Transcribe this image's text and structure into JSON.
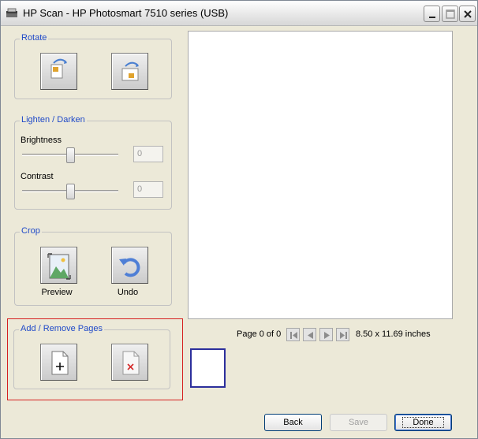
{
  "window": {
    "title": "HP Scan - HP Photosmart 7510 series (USB)"
  },
  "rotate": {
    "label": "Rotate",
    "buttons": [
      {
        "icon": "rotate-left-icon"
      },
      {
        "icon": "rotate-right-icon"
      }
    ]
  },
  "lighten_darken": {
    "label": "Lighten / Darken",
    "brightness": {
      "label": "Brightness",
      "value": "0",
      "level": 0.5
    },
    "contrast": {
      "label": "Contrast",
      "value": "0",
      "level": 0.5
    }
  },
  "crop": {
    "label": "Crop",
    "preview_label": "Preview",
    "undo_label": "Undo"
  },
  "pages": {
    "label": "Add / Remove Pages",
    "highlight_color": "#d52020"
  },
  "navigation": {
    "page_text": "Page 0 of 0",
    "dimensions": "8.50 x 11.69 inches"
  },
  "footer": {
    "back_label": "Back",
    "save_label": "Save",
    "done_label": "Done"
  },
  "colors": {
    "group_label": "#1f49c8",
    "thumbnail_border": "#2c2f9c"
  }
}
